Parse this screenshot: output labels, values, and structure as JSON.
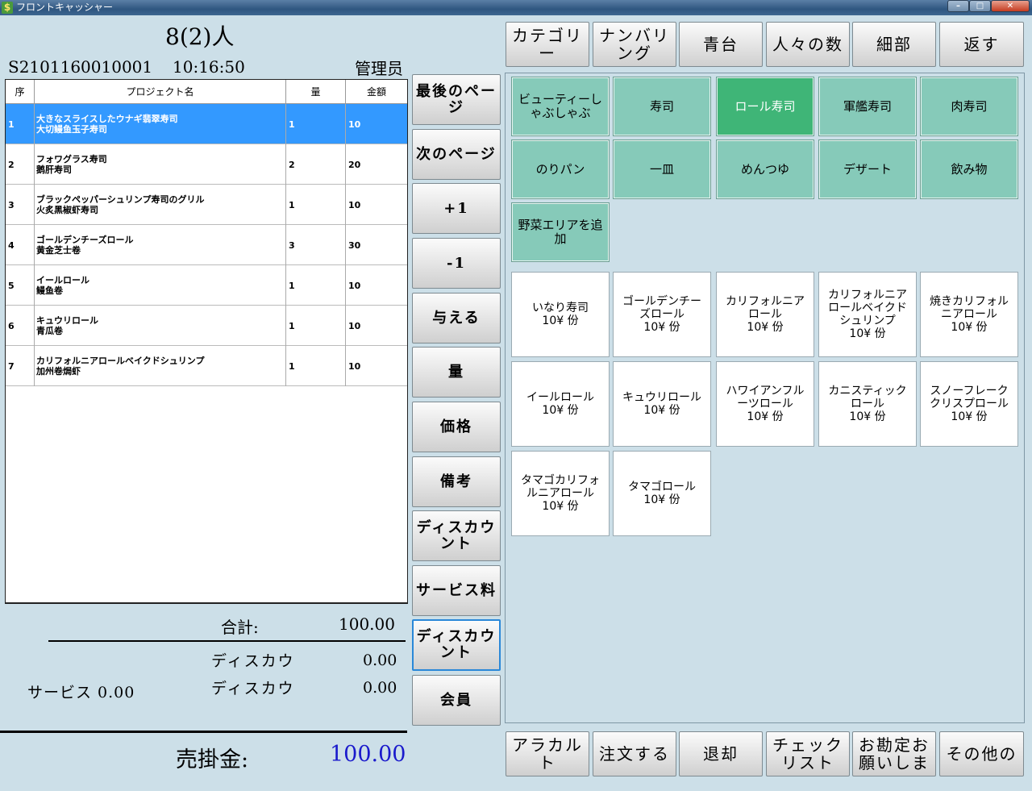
{
  "window": {
    "title": "フロントキャッシャー",
    "icon": "dollar-icon"
  },
  "header": {
    "guests": "8(2)人",
    "order_no": "S2101160010001",
    "time": "10:16:50",
    "operator": "管理员"
  },
  "order_table": {
    "columns": [
      "序",
      "プロジェクト名",
      "量",
      "金額"
    ],
    "rows": [
      {
        "seq": "1",
        "name1": "大きなスライスしたウナギ翡翠寿司",
        "name2": "大切鳗鱼玉子寿司",
        "qty": "1",
        "amount": "10"
      },
      {
        "seq": "2",
        "name1": "フォワグラス寿司",
        "name2": "鹅肝寿司",
        "qty": "2",
        "amount": "20"
      },
      {
        "seq": "3",
        "name1": "ブラックペッパーシュリンプ寿司のグリル",
        "name2": "火炙黑椒虾寿司",
        "qty": "1",
        "amount": "10"
      },
      {
        "seq": "4",
        "name1": "ゴールデンチーズロール",
        "name2": "黄金芝士卷",
        "qty": "3",
        "amount": "30"
      },
      {
        "seq": "5",
        "name1": "イールロール",
        "name2": "鳗鱼卷",
        "qty": "1",
        "amount": "10"
      },
      {
        "seq": "6",
        "name1": "キュウリロール",
        "name2": "青瓜卷",
        "qty": "1",
        "amount": "10"
      },
      {
        "seq": "7",
        "name1": "カリフォルニアロールベイクドシュリンプ",
        "name2": "加州卷焗虾",
        "qty": "1",
        "amount": "10"
      }
    ]
  },
  "totals": {
    "subtotal_label": "合計:",
    "subtotal": "100.00",
    "discount1_label": "ディスカウ",
    "discount1": "0.00",
    "discount2_label": "ディスカウ",
    "discount2": "0.00",
    "service": "サービス 0.00",
    "due_label": "売掛金:",
    "due": "100.00"
  },
  "side_buttons": [
    "最後のページ",
    "次のページ",
    "+1",
    "-1",
    "与える",
    "量",
    "価格",
    "備考",
    "ディスカウント",
    "サービス料",
    "ディスカウント",
    "会員"
  ],
  "top_buttons": [
    "カテゴリー",
    "ナンバリング",
    "青台",
    "人々の数",
    "細部",
    "返す"
  ],
  "categories": [
    "ビューティーしゃぶしゃぶ",
    "寿司",
    "ロール寿司",
    "軍艦寿司",
    "肉寿司",
    "のりパン",
    "一皿",
    "めんつゆ",
    "デザート",
    "飲み物",
    "野菜エリアを追加"
  ],
  "active_category": "ロール寿司",
  "dishes": [
    {
      "name": "いなり寿司",
      "price": "10¥ 份"
    },
    {
      "name": "ゴールデンチーズロール",
      "price": "10¥ 份"
    },
    {
      "name": "カリフォルニアロール",
      "price": "10¥ 份"
    },
    {
      "name": "カリフォルニアロールベイクドシュリンプ",
      "price": "10¥ 份"
    },
    {
      "name": "焼きカリフォルニアロール",
      "price": "10¥ 份"
    },
    {
      "name": "イールロール",
      "price": "10¥ 份"
    },
    {
      "name": "キュウリロール",
      "price": "10¥ 份"
    },
    {
      "name": "ハワイアンフルーツロール",
      "price": "10¥ 份"
    },
    {
      "name": "カニスティックロール",
      "price": "10¥ 份"
    },
    {
      "name": "スノーフレーククリスプロール",
      "price": "10¥ 份"
    },
    {
      "name": "タマゴカリフォルニアロール",
      "price": "10¥ 份"
    },
    {
      "name": "タマゴロール",
      "price": "10¥ 份"
    }
  ],
  "bottom_buttons": [
    "アラカルト",
    "注文する",
    "退却",
    "チェックリスト",
    "お勘定お願いしま",
    "その他の"
  ],
  "colors": {
    "selected_row": "#3399ff",
    "category": "#86cab9",
    "active_category": "#3fb577",
    "due": "#1a1acc"
  }
}
